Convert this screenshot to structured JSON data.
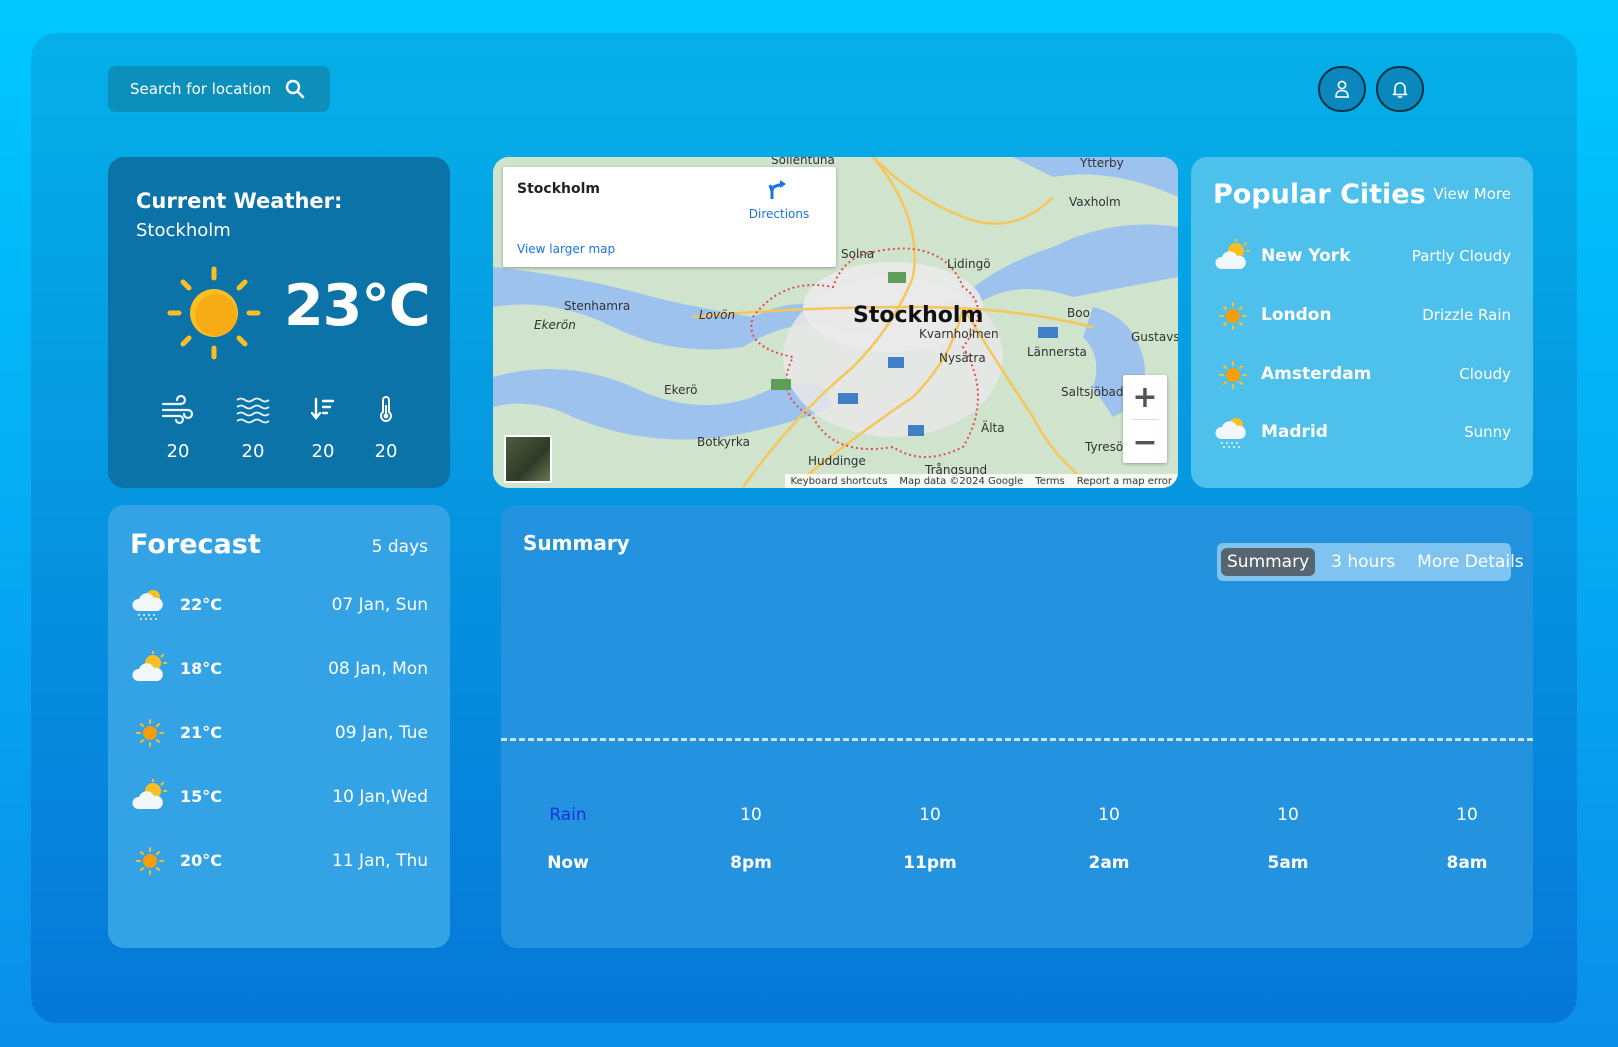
{
  "search": {
    "placeholder": "Search for location"
  },
  "header": {
    "user_icon": "user-icon",
    "bell_icon": "bell-icon"
  },
  "current": {
    "title": "Current Weather:",
    "city": "Stockholm",
    "temperature": "23°C",
    "icon": "sun-icon",
    "metrics": [
      {
        "icon": "wind-icon",
        "value": "20"
      },
      {
        "icon": "waves-icon",
        "value": "20"
      },
      {
        "icon": "pressure-icon",
        "value": "20"
      },
      {
        "icon": "thermometer-icon",
        "value": "20"
      }
    ]
  },
  "map": {
    "place": "Stockholm",
    "directions": "Directions",
    "larger_map": "View larger map",
    "center_label": "Stockholm",
    "labels": [
      "Sollentuna",
      "Ytterby",
      "Vaxholm",
      "Solna",
      "Lidingö",
      "Stenhamra",
      "Ekerön",
      "Lovön",
      "Boo",
      "Gustavs",
      "Kvarnholmen",
      "Nysätra",
      "Lännersta",
      "Ekerö",
      "Saltsjöbad",
      "Botkyrka",
      "Älta",
      "Tyresö",
      "Huddinge",
      "Trångsund"
    ],
    "zoom_in": "+",
    "zoom_out": "−",
    "attribution": [
      "Keyboard shortcuts",
      "Map data ©2024 Google",
      "Terms",
      "Report a map error"
    ]
  },
  "cities": {
    "title": "Popular Cities",
    "view_more": "View More",
    "items": [
      {
        "name": "New York",
        "condition": "Partly Cloudy",
        "icon": "partly-cloudy-icon"
      },
      {
        "name": "London",
        "condition": "Drizzle Rain",
        "icon": "sun-icon"
      },
      {
        "name": "Amsterdam",
        "condition": "Cloudy",
        "icon": "sun-icon"
      },
      {
        "name": "Madrid",
        "condition": "Sunny",
        "icon": "snow-cloud-icon"
      }
    ]
  },
  "forecast": {
    "title": "Forecast",
    "days": "5 days",
    "items": [
      {
        "temp": "22°C",
        "date": "07 Jan, Sun",
        "icon": "snow-cloud-icon"
      },
      {
        "temp": "18°C",
        "date": "08 Jan, Mon",
        "icon": "partly-cloudy-icon"
      },
      {
        "temp": "21°C",
        "date": "09 Jan, Tue",
        "icon": "sun-icon"
      },
      {
        "temp": "15°C",
        "date": "10 Jan,Wed",
        "icon": "partly-cloudy-icon"
      },
      {
        "temp": "20°C",
        "date": "11 Jan, Thu",
        "icon": "sun-icon"
      }
    ]
  },
  "summary": {
    "title": "Summary",
    "tabs": [
      "Summary",
      "3 hours",
      "More Details"
    ],
    "active_tab": "Summary",
    "hours": [
      {
        "rain": "Rain",
        "time": "Now"
      },
      {
        "rain": "10",
        "time": "8pm"
      },
      {
        "rain": "10",
        "time": "11pm"
      },
      {
        "rain": "10",
        "time": "2am"
      },
      {
        "rain": "10",
        "time": "5am"
      },
      {
        "rain": "10",
        "time": "8am"
      }
    ]
  },
  "colors": {
    "accent": "#00c8ff",
    "sun": "#fbbf24",
    "card": "#0b73a7",
    "rain_label": "#1a35d8"
  }
}
